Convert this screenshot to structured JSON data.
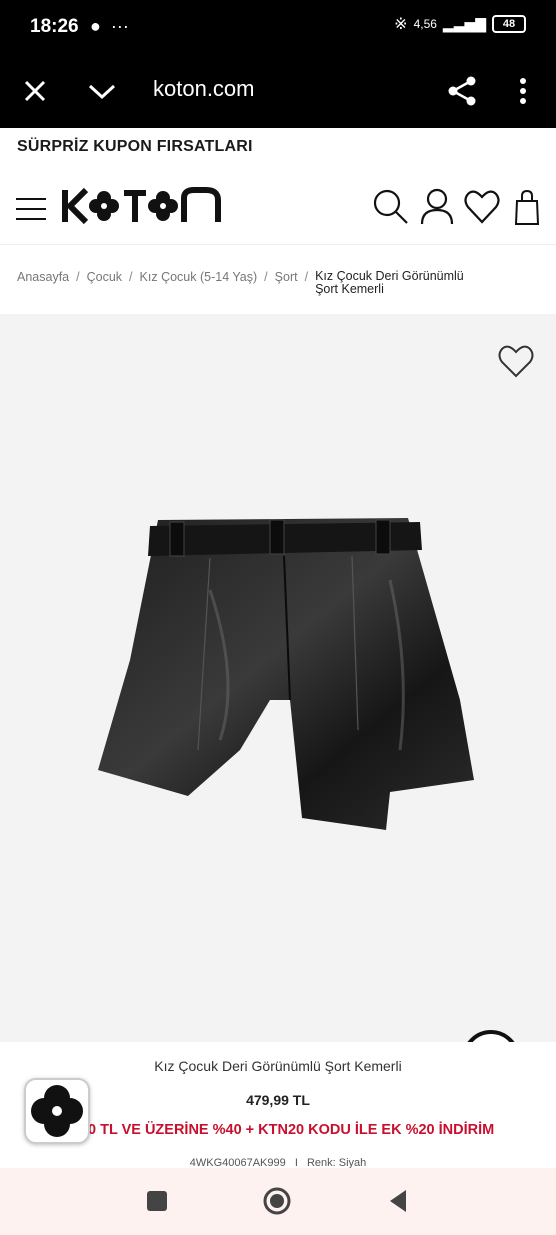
{
  "status_bar": {
    "time": "18:26",
    "left_icons": [
      "chat-icon",
      "more-icon"
    ],
    "network": "4,56",
    "battery": "48"
  },
  "browser": {
    "url": "koton.com"
  },
  "promo_banner": "SÜRPRİZ KUPON FIRSATLARI",
  "header": {
    "brand": "KOTON"
  },
  "breadcrumb": {
    "items": [
      "Anasayfa",
      "Çocuk",
      "Kız Çocuk (5-14 Yaş)",
      "Şort"
    ],
    "separator": "/",
    "current": "Kız Çocuk Deri Görünümlü Şort Kemerli"
  },
  "product": {
    "title": "Kız Çocuk Deri Görünümlü Şort Kemerli",
    "price": "479,99 TL",
    "promo": "0 TL VE ÜZERİNE %40 + KTN20 KODU İLE EK %20 İNDİRİM",
    "sku": "4WKG40067AK999",
    "meta_separator": "I",
    "color": "Renk: Siyah"
  },
  "colors": {
    "promo_red": "#c8102e",
    "image_bg": "#f3f3f3",
    "nav_bg": "#fdf2f0"
  }
}
